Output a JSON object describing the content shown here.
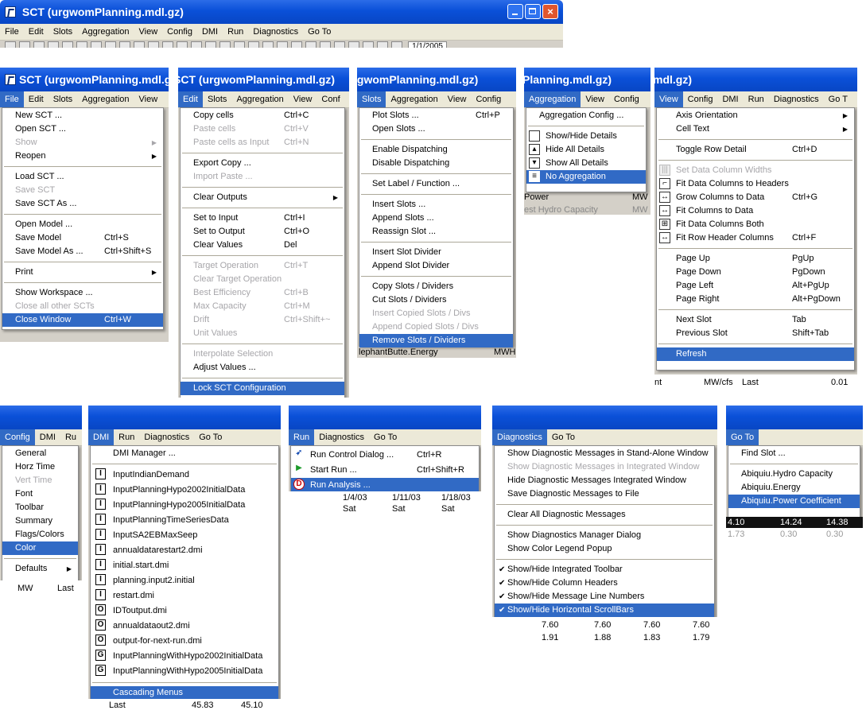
{
  "top_window": {
    "title": "SCT  (urgwomPlanning.mdl.gz)",
    "menubar": [
      "File",
      "Edit",
      "Slots",
      "Aggregation",
      "View",
      "Config",
      "DMI",
      "Run",
      "Diagnostics",
      "Go To"
    ],
    "toolbar_readout": "1/1/2005"
  },
  "file_panel": {
    "title": "SCT  (urgwomPlanning.mdl.gz",
    "menubar": [
      "File",
      "Edit",
      "Slots",
      "Aggregation",
      "View"
    ],
    "items": [
      {
        "label": "New SCT ..."
      },
      {
        "label": "Open SCT ..."
      },
      {
        "label": "Show",
        "disabled": true,
        "submenu": true
      },
      {
        "label": "Reopen",
        "submenu": true
      },
      {
        "sep": true
      },
      {
        "label": "Load SCT ..."
      },
      {
        "label": "Save SCT",
        "disabled": true
      },
      {
        "label": "Save SCT As ..."
      },
      {
        "sep": true
      },
      {
        "label": "Open Model ..."
      },
      {
        "label": "Save Model",
        "shortcut": "Ctrl+S"
      },
      {
        "label": "Save Model As ...",
        "shortcut": "Ctrl+Shift+S"
      },
      {
        "sep": true
      },
      {
        "label": "Print",
        "submenu": true
      },
      {
        "sep": true
      },
      {
        "label": "Show Workspace ..."
      },
      {
        "label": "Close all other SCTs",
        "disabled": true
      },
      {
        "label": "Close Window",
        "shortcut": "Ctrl+W",
        "selected": true
      }
    ]
  },
  "edit_panel": {
    "title": "SCT  (urgwomPlanning.mdl.gz)",
    "menubar": [
      "Edit",
      "Slots",
      "Aggregation",
      "View",
      "Conf"
    ],
    "items": [
      {
        "label": "Copy cells",
        "shortcut": "Ctrl+C"
      },
      {
        "label": "Paste cells",
        "shortcut": "Ctrl+V",
        "disabled": true
      },
      {
        "label": "Paste cells as Input",
        "shortcut": "Ctrl+N",
        "disabled": true
      },
      {
        "sep": true
      },
      {
        "label": "Export Copy ..."
      },
      {
        "label": "Import Paste ...",
        "disabled": true
      },
      {
        "sep": true
      },
      {
        "label": "Clear Outputs",
        "submenu": true
      },
      {
        "sep": true
      },
      {
        "label": "Set to Input",
        "shortcut": "Ctrl+I"
      },
      {
        "label": "Set to Output",
        "shortcut": "Ctrl+O"
      },
      {
        "label": "Clear Values",
        "shortcut": "Del"
      },
      {
        "sep": true
      },
      {
        "label": "Target Operation",
        "shortcut": "Ctrl+T",
        "disabled": true
      },
      {
        "label": "Clear Target Operation",
        "disabled": true
      },
      {
        "label": "Best Efficiency",
        "shortcut": "Ctrl+B",
        "disabled": true
      },
      {
        "label": "Max Capacity",
        "shortcut": "Ctrl+M",
        "disabled": true
      },
      {
        "label": "Drift",
        "shortcut": "Ctrl+Shift+~",
        "disabled": true
      },
      {
        "label": "Unit Values",
        "disabled": true
      },
      {
        "sep": true
      },
      {
        "label": "Interpolate Selection",
        "disabled": true
      },
      {
        "label": "Adjust Values ..."
      },
      {
        "sep": true
      },
      {
        "label": "Lock SCT Configuration",
        "selected": true
      }
    ]
  },
  "slots_panel": {
    "title": "lgwomPlanning.mdl.gz)",
    "menubar": [
      "Slots",
      "Aggregation",
      "View",
      "Config"
    ],
    "items": [
      {
        "label": "Plot Slots ...",
        "shortcut": "Ctrl+P"
      },
      {
        "label": "Open Slots ..."
      },
      {
        "sep": true
      },
      {
        "label": "Enable Dispatching"
      },
      {
        "label": "Disable Dispatching"
      },
      {
        "sep": true
      },
      {
        "label": "Set Label / Function ..."
      },
      {
        "sep": true
      },
      {
        "label": "Insert Slots ..."
      },
      {
        "label": "Append Slots ..."
      },
      {
        "label": "Reassign Slot ..."
      },
      {
        "sep": true
      },
      {
        "label": "Insert Slot Divider"
      },
      {
        "label": "Append Slot Divider"
      },
      {
        "sep": true
      },
      {
        "label": "Copy Slots / Dividers"
      },
      {
        "label": "Cut Slots / Dividers"
      },
      {
        "label": "Insert Copied Slots / Divs",
        "disabled": true
      },
      {
        "label": "Append Copied Slots / Divs",
        "disabled": true
      },
      {
        "label": "Remove Slots / Dividers",
        "selected": true
      }
    ],
    "below_text": "lephantButte.Energy",
    "below_unit": "MWH"
  },
  "aggregation_panel": {
    "title": "Planning.mdl.gz)",
    "menubar": [
      "Aggregation",
      "View",
      "Config"
    ],
    "items": [
      {
        "label": "Aggregation Config ..."
      },
      {
        "sep": true
      },
      {
        "label": "Show/Hide Details",
        "icon": "show-hide-details-icon"
      },
      {
        "label": "Hide All Details",
        "icon": "hide-all-details-icon"
      },
      {
        "label": "Show All Details",
        "icon": "show-all-details-icon"
      },
      {
        "label": "No Aggregation",
        "icon": "no-aggregation-icon",
        "selected": true
      }
    ],
    "rows": [
      {
        "name": "Power",
        "unit": "MW"
      },
      {
        "name": "est Hydro Capacity",
        "unit": "MW"
      }
    ]
  },
  "view_panel": {
    "title": "mdl.gz)",
    "menubar": [
      "View",
      "Config",
      "DMI",
      "Run",
      "Diagnostics",
      "Go T"
    ],
    "items": [
      {
        "label": "Axis Orientation",
        "submenu": true
      },
      {
        "label": "Cell Text",
        "submenu": true
      },
      {
        "sep": true
      },
      {
        "label": "Toggle Row Detail",
        "shortcut": "Ctrl+D"
      },
      {
        "sep": true
      },
      {
        "label": "Set Data Column Widths",
        "disabled": true,
        "icon": "column-widths-icon"
      },
      {
        "label": "Fit Data Columns to Headers",
        "icon": "fit-headers-icon"
      },
      {
        "label": "Grow Columns to Data",
        "shortcut": "Ctrl+G",
        "icon": "grow-columns-icon"
      },
      {
        "label": "Fit Columns to Data",
        "icon": "fit-data-icon"
      },
      {
        "label": "Fit Data Columns Both",
        "icon": "fit-both-icon"
      },
      {
        "label": "Fit Row Header Columns",
        "shortcut": "Ctrl+F",
        "icon": "fit-row-header-icon"
      },
      {
        "sep": true
      },
      {
        "label": "Page Up",
        "shortcut": "PgUp"
      },
      {
        "label": "Page Down",
        "shortcut": "PgDown"
      },
      {
        "label": "Page Left",
        "shortcut": "Alt+PgUp"
      },
      {
        "label": "Page Right",
        "shortcut": "Alt+PgDown"
      },
      {
        "sep": true
      },
      {
        "label": "Next Slot",
        "shortcut": "Tab"
      },
      {
        "label": "Previous Slot",
        "shortcut": "Shift+Tab"
      },
      {
        "sep": true
      },
      {
        "label": "Refresh",
        "selected": true
      }
    ],
    "below": {
      "name": "nt",
      "unit": "MW/cfs",
      "col": "Last",
      "value": "0.01"
    }
  },
  "config_panel": {
    "menubar": [
      "Config",
      "DMI",
      "Ru"
    ],
    "items": [
      {
        "label": "General"
      },
      {
        "label": "Horz Time"
      },
      {
        "label": "Vert Time",
        "disabled": true
      },
      {
        "label": "Font"
      },
      {
        "label": "Toolbar"
      },
      {
        "label": "Summary"
      },
      {
        "label": "Flags/Colors"
      },
      {
        "label": "Color",
        "selected": true
      },
      {
        "sep": true
      },
      {
        "label": "Defaults",
        "submenu": true
      }
    ],
    "below": {
      "unit": "MW",
      "col": "Last"
    }
  },
  "dmi_panel": {
    "menubar": [
      "DMI",
      "Run",
      "Diagnostics",
      "Go To"
    ],
    "items": [
      {
        "label": "DMI Manager ..."
      },
      {
        "sep": true
      },
      {
        "label": "InputIndianDemand",
        "icon": "I"
      },
      {
        "label": "InputPlanningHypo2002InitialData",
        "icon": "I"
      },
      {
        "label": "InputPlanningHypo2005InitialData",
        "icon": "I"
      },
      {
        "label": "InputPlanningTimeSeriesData",
        "icon": "I"
      },
      {
        "label": "InputSA2EBMaxSeep",
        "icon": "I"
      },
      {
        "label": "annualdatarestart2.dmi",
        "icon": "I"
      },
      {
        "label": "initial.start.dmi",
        "icon": "I"
      },
      {
        "label": "planning.input2.initial",
        "icon": "I"
      },
      {
        "label": "restart.dmi",
        "icon": "I"
      },
      {
        "label": "IDToutput.dmi",
        "icon": "O"
      },
      {
        "label": "annualdataout2.dmi",
        "icon": "O"
      },
      {
        "label": "output-for-next-run.dmi",
        "icon": "O"
      },
      {
        "label": "InputPlanningWithHypo2002InitialData",
        "icon": "G"
      },
      {
        "label": "InputPlanningWithHypo2005InitialData",
        "icon": "G"
      },
      {
        "sep": true
      },
      {
        "label": "Cascading Menus",
        "selected": true
      }
    ],
    "below": {
      "col": "Last",
      "v1": "45.83",
      "v2": "45.10"
    }
  },
  "run_panel": {
    "menubar": [
      "Run",
      "Diagnostics",
      "Go To"
    ],
    "items": [
      {
        "label": "Run Control Dialog ...",
        "shortcut": "Ctrl+R",
        "icon": "run-control-icon"
      },
      {
        "label": "Start Run ...",
        "shortcut": "Ctrl+Shift+R",
        "icon": "start-run-icon"
      },
      {
        "label": "Run Analysis ...",
        "icon": "run-analysis-icon",
        "selected": true
      }
    ],
    "dates": [
      "1/4/03",
      "1/11/03",
      "1/18/03"
    ],
    "days": [
      "Sat",
      "Sat",
      "Sat"
    ]
  },
  "diagnostics_panel": {
    "menubar": [
      "Diagnostics",
      "Go To"
    ],
    "items": [
      {
        "label": "Show Diagnostic Messages in Stand-Alone Window"
      },
      {
        "label": "Show Diagnostic Messages in Integrated Window",
        "disabled": true
      },
      {
        "label": "Hide Diagnostic Messages Integrated Window"
      },
      {
        "label": "Save Diagnostic Messages to File"
      },
      {
        "sep": true
      },
      {
        "label": "Clear All Diagnostic Messages"
      },
      {
        "sep": true
      },
      {
        "label": "Show Diagnostics Manager Dialog"
      },
      {
        "label": "Show Color Legend Popup"
      },
      {
        "sep": true
      },
      {
        "label": "Show/Hide Integrated Toolbar",
        "checked": true
      },
      {
        "label": "Show/Hide Column Headers",
        "checked": true
      },
      {
        "label": "Show/Hide Message Line Numbers",
        "checked": true
      },
      {
        "label": "Show/Hide Horizontal ScrollBars",
        "checked": true,
        "selected": true
      }
    ],
    "rows": [
      [
        "7.60",
        "7.60",
        "7.60",
        "7.60"
      ],
      [
        "1.91",
        "1.88",
        "1.83",
        "1.79"
      ]
    ]
  },
  "goto_panel": {
    "menubar": [
      "Go To"
    ],
    "items": [
      {
        "label": "Find Slot ..."
      },
      {
        "sep": true
      },
      {
        "label": "Abiquiu.Hydro Capacity"
      },
      {
        "label": "Abiquiu.Energy"
      },
      {
        "label": "Abiquiu.Power Coefficient",
        "selected": true
      }
    ],
    "rows": [
      [
        "4.10",
        "14.24",
        "14.38"
      ],
      [
        "1.73",
        "0.30",
        "0.30"
      ]
    ]
  }
}
